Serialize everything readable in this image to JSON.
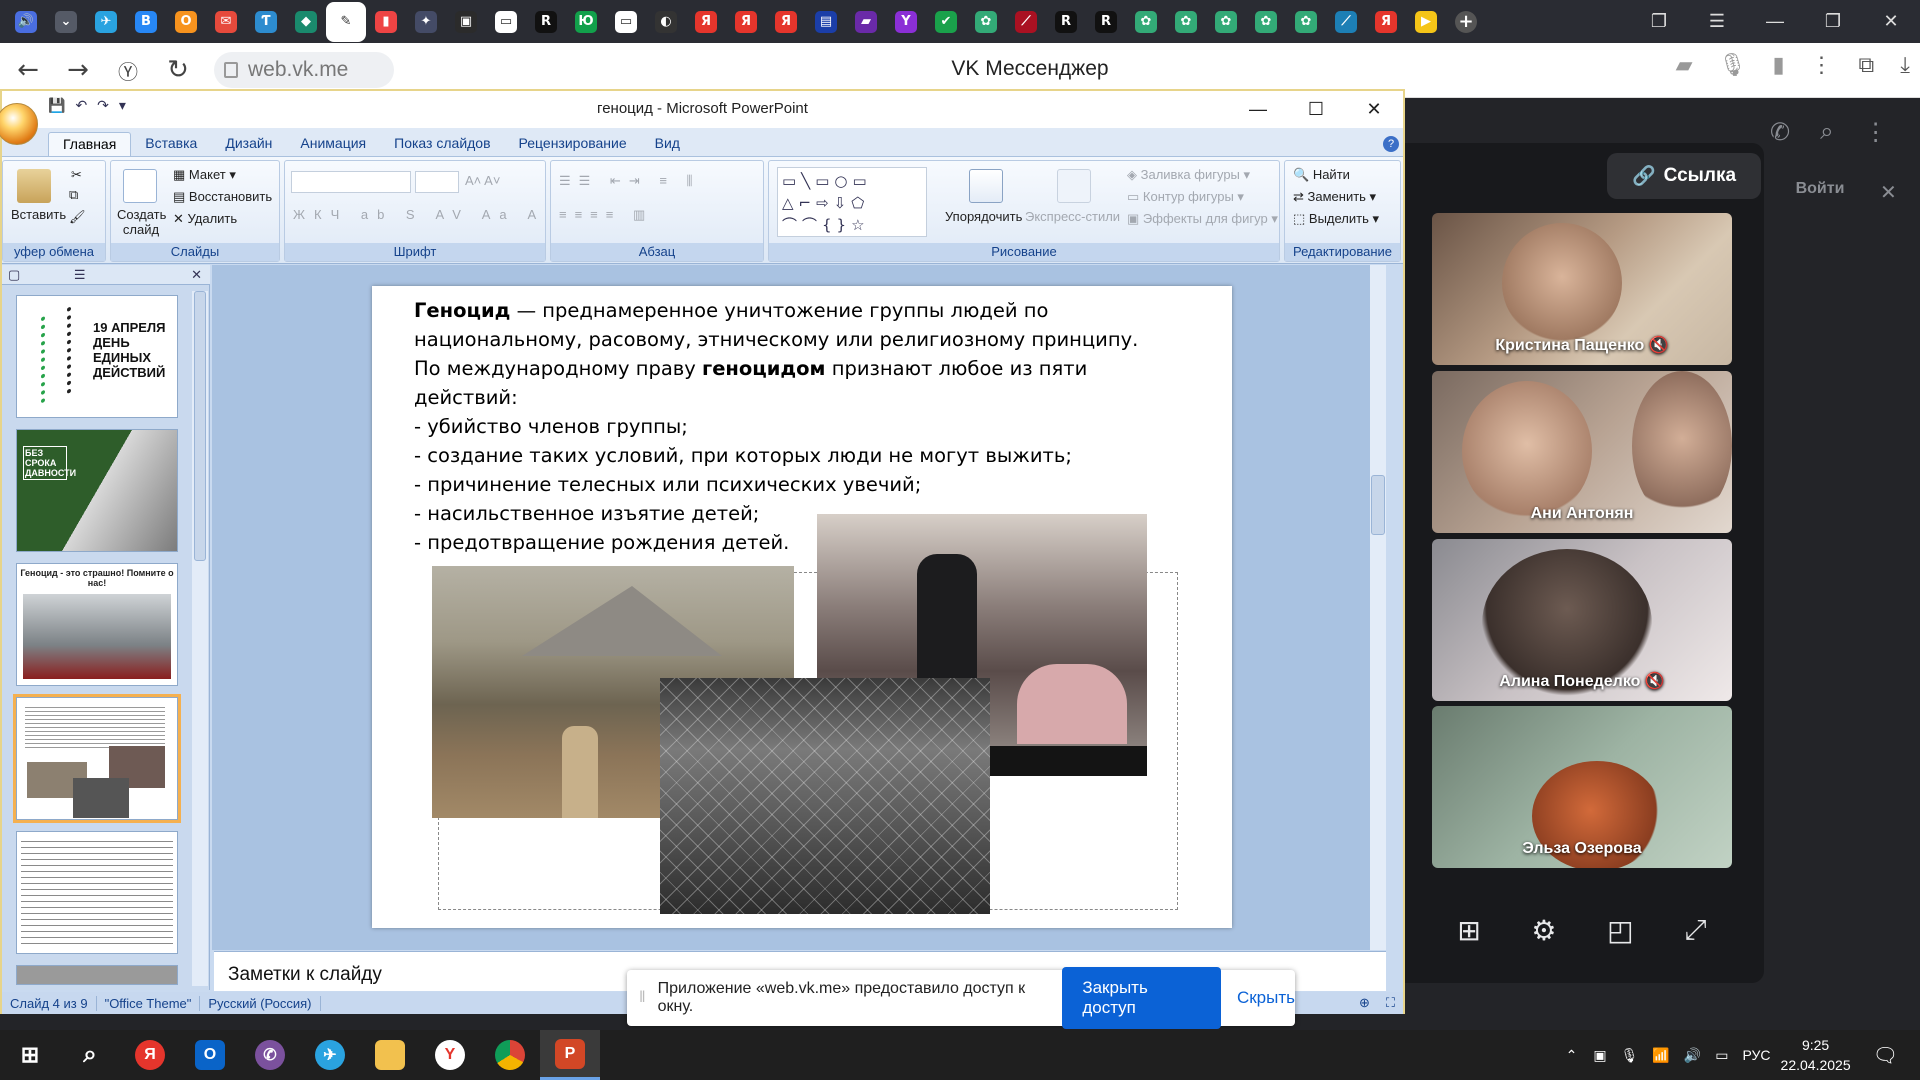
{
  "browser": {
    "url": "web.vk.me",
    "page_title": "VK Мессенджер",
    "tab_icons": [
      {
        "name": "volume-tab-icon",
        "color": "#4a6ee0",
        "glyph": "🔊"
      },
      {
        "name": "tab-list-icon",
        "color": "#555a66",
        "glyph": "⌄"
      },
      {
        "name": "telegram-icon",
        "color": "#2aa3e0",
        "glyph": "✈"
      },
      {
        "name": "vk-icon",
        "color": "#2787f5",
        "glyph": "В"
      },
      {
        "name": "ok-icon",
        "color": "#f7931e",
        "glyph": "О"
      },
      {
        "name": "mail-icon",
        "color": "#e64a3c",
        "glyph": "✉"
      },
      {
        "name": "tab-icon",
        "color": "#2d8ccf",
        "glyph": "Ƭ"
      },
      {
        "name": "tab-icon",
        "color": "#1a8a6d",
        "glyph": "◆"
      },
      {
        "name": "tab-icon",
        "color": "#ffffff",
        "glyph": "✎"
      },
      {
        "name": "tab-icon",
        "color": "#e44",
        "glyph": "▮"
      },
      {
        "name": "tab-icon",
        "color": "#444b66",
        "glyph": "✦"
      },
      {
        "name": "tab-icon",
        "color": "#2b2b2b",
        "glyph": "▣"
      },
      {
        "name": "document-icon",
        "color": "#ffffff",
        "glyph": "▭"
      },
      {
        "name": "tab-icon",
        "color": "#111",
        "glyph": "R"
      },
      {
        "name": "tab-icon",
        "color": "#12a04b",
        "glyph": "Ю"
      },
      {
        "name": "document-icon",
        "color": "#ffffff",
        "glyph": "▭"
      },
      {
        "name": "tab-icon",
        "color": "#333",
        "glyph": "◐"
      },
      {
        "name": "yandex-icon",
        "color": "#e5352c",
        "glyph": "Я"
      },
      {
        "name": "yandex-icon",
        "color": "#e5352c",
        "glyph": "Я"
      },
      {
        "name": "yandex-icon",
        "color": "#e5352c",
        "glyph": "Я"
      },
      {
        "name": "tab-icon",
        "color": "#1b3ea8",
        "glyph": "▤"
      },
      {
        "name": "tab-icon",
        "color": "#6a2aa8",
        "glyph": "▰"
      },
      {
        "name": "tab-icon",
        "color": "#8b2fd6",
        "glyph": "Y"
      },
      {
        "name": "tab-icon",
        "color": "#1aa14b",
        "glyph": "✔"
      },
      {
        "name": "tab-icon",
        "color": "#3a7",
        "glyph": "✿"
      },
      {
        "name": "tab-icon",
        "color": "#a12",
        "glyph": "⟋"
      },
      {
        "name": "tab-icon",
        "color": "#111",
        "glyph": "R"
      },
      {
        "name": "tab-icon",
        "color": "#111",
        "glyph": "R"
      },
      {
        "name": "tab-icon",
        "color": "#3a7",
        "glyph": "✿"
      },
      {
        "name": "tab-icon",
        "color": "#3a7",
        "glyph": "✿"
      },
      {
        "name": "tab-icon",
        "color": "#3a7",
        "glyph": "✿"
      },
      {
        "name": "tab-icon",
        "color": "#3a7",
        "glyph": "✿"
      },
      {
        "name": "tab-icon",
        "color": "#3a7",
        "glyph": "✿"
      },
      {
        "name": "tab-icon",
        "color": "#1d7fb5",
        "glyph": "⟋"
      },
      {
        "name": "yandex-icon",
        "color": "#e5352c",
        "glyph": "Я"
      },
      {
        "name": "tab-icon",
        "color": "#f5c518",
        "glyph": "▶"
      }
    ]
  },
  "ppt": {
    "title": "геноцид - Microsoft PowerPoint",
    "tabs": [
      "Главная",
      "Вставка",
      "Дизайн",
      "Анимация",
      "Показ слайдов",
      "Рецензирование",
      "Вид"
    ],
    "groups": {
      "clipboard": "уфер обмена",
      "slides": "Слайды",
      "font": "Шрифт",
      "paragraph": "Абзац",
      "drawing": "Рисование",
      "editing": "Редактирование"
    },
    "buttons": {
      "paste": "Вставить",
      "new_slide": "Создать слайд",
      "layout": "Макет",
      "reset": "Восстановить",
      "delete": "Удалить",
      "arrange": "Упорядочить",
      "quick_styles": "Экспресс-стили",
      "shape_fill": "Заливка фигуры",
      "shape_outline": "Контур фигуры",
      "shape_effects": "Эффекты для фигур",
      "find": "Найти",
      "replace": "Заменить",
      "select": "Выделить"
    },
    "thumbs": [
      {
        "title": "19 АПРЕЛЯ ДЕНЬ ЕДИНЫХ ДЕЙСТВИЙ"
      },
      {
        "title": "БЕЗ СРОКА ДАВНОСТИ"
      },
      {
        "title": "Геноцид - это страшно! Помните о нас!"
      }
    ],
    "slide": {
      "term": "Геноцид",
      "line1_rest": " — преднамеренное уничтожение группы людей по",
      "line2": "национальному, расовому, этническому или религиозному принципу.",
      "line3_a": "По международному праву ",
      "line3_bold": "геноцидом",
      "line3_b": " признают любое из пяти",
      "line4": "действий:",
      "items": [
        "- убийство членов группы;",
        " - создание таких условий, при которых люди не могут выжить;",
        " - причинение телесных или психических увечий;",
        " - насильственное изъятие детей;",
        " - предотвращение рождения детей."
      ]
    },
    "notes_placeholder": "Заметки к слайду",
    "status": {
      "slide": "Слайд 4 из 9",
      "theme": "\"Office Theme\"",
      "lang": "Русский (Россия)"
    }
  },
  "vk": {
    "link_button": "Ссылка",
    "login": "Войти",
    "participants": [
      {
        "name": "Кристина Пащенко",
        "muted": true
      },
      {
        "name": "Ани Антонян",
        "muted": false
      },
      {
        "name": "Алина Понеделко",
        "muted": true
      },
      {
        "name": "Эльза Озерова",
        "muted": false
      }
    ]
  },
  "share_notice": {
    "message": "Приложение «web.vk.me» предоставило доступ к окну.",
    "stop_button": "Закрыть доступ",
    "hide_link": "Скрыть"
  },
  "taskbar": {
    "lang": "РУС",
    "time": "9:25",
    "date": "22.04.2025"
  }
}
